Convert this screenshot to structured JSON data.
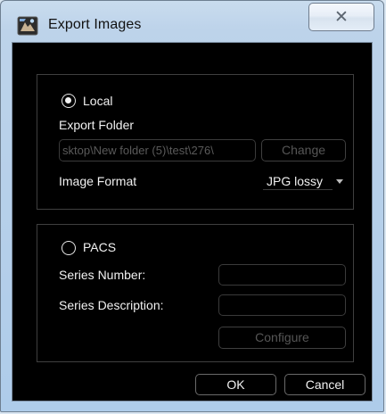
{
  "window": {
    "title": "Export Images",
    "close_glyph": "✕"
  },
  "local": {
    "radio_label": "Local",
    "selected": true,
    "export_folder_label": "Export Folder",
    "export_folder_value": "sktop\\New folder (5)\\test\\276\\",
    "change_button": "Change",
    "image_format_label": "Image Format",
    "image_format_value": "JPG lossy"
  },
  "pacs": {
    "radio_label": "PACS",
    "selected": false,
    "series_number_label": "Series Number:",
    "series_number_value": "",
    "series_description_label": "Series Description:",
    "series_description_value": "",
    "configure_button": "Configure"
  },
  "footer": {
    "ok_button": "OK",
    "cancel_button": "Cancel"
  },
  "colors": {
    "client_background": "#000000",
    "text": "#f1f1f1",
    "disabled_text": "#565656",
    "titlebar": "#bdd3ea"
  },
  "icons": {
    "app": "export-images-app-icon",
    "close": "close-icon",
    "dropdown": "chevron-down-icon"
  }
}
